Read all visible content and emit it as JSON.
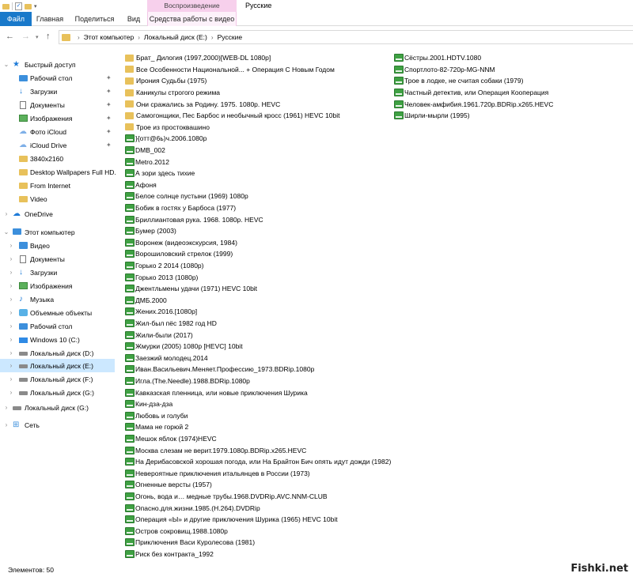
{
  "ribbon": {
    "context_group": "Воспроизведение",
    "window_title": "Русские",
    "tabs": {
      "file": "Файл",
      "home": "Главная",
      "share": "Поделиться",
      "view": "Вид",
      "video_tools": "Средства работы с видео"
    }
  },
  "address": {
    "crumbs": [
      "Этот компьютер",
      "Локальный диск (E:)",
      "Русские"
    ]
  },
  "sidebar": {
    "quick_access": "Быстрый доступ",
    "quick_items": [
      {
        "label": "Рабочий стол",
        "icon": "desktop-icon"
      },
      {
        "label": "Загрузки",
        "icon": "download-icon"
      },
      {
        "label": "Документы",
        "icon": "documents-icon"
      },
      {
        "label": "Изображения",
        "icon": "pictures-icon"
      },
      {
        "label": "Фото iCloud",
        "icon": "icloud-photos-icon"
      },
      {
        "label": "iCloud Drive",
        "icon": "icloud-drive-icon"
      },
      {
        "label": "3840x2160",
        "icon": "folder-icon"
      },
      {
        "label": "Desktop Wallpapers Full HD. I",
        "icon": "folder-icon"
      },
      {
        "label": "From Internet",
        "icon": "folder-icon"
      },
      {
        "label": "Video",
        "icon": "folder-icon"
      }
    ],
    "onedrive": "OneDrive",
    "this_pc": "Этот компьютер",
    "pc_items": [
      {
        "label": "Видео",
        "icon": "videos-icon"
      },
      {
        "label": "Документы",
        "icon": "documents-icon"
      },
      {
        "label": "Загрузки",
        "icon": "download-icon"
      },
      {
        "label": "Изображения",
        "icon": "pictures-icon"
      },
      {
        "label": "Музыка",
        "icon": "music-icon"
      },
      {
        "label": "Объемные объекты",
        "icon": "3d-objects-icon"
      },
      {
        "label": "Рабочий стол",
        "icon": "desktop-icon"
      },
      {
        "label": "Windows 10 (C:)",
        "icon": "windows-drive-icon"
      },
      {
        "label": "Локальный диск (D:)",
        "icon": "drive-icon"
      },
      {
        "label": "Локальный диск (E:)",
        "icon": "drive-icon"
      },
      {
        "label": "Локальный диск (F:)",
        "icon": "drive-icon"
      },
      {
        "label": "Локальный диск (G:)",
        "icon": "drive-icon"
      }
    ],
    "extra_drive": "Локальный диск (G:)",
    "network": "Сеть"
  },
  "files": {
    "column1": [
      {
        "name": "Брат_ Дилогия (1997,2000)[WEB-DL 1080p]",
        "type": "folder"
      },
      {
        "name": "Все Особенности Национальной... + Операция С Новым Годом",
        "type": "folder"
      },
      {
        "name": "Ирония Судьбы (1975)",
        "type": "folder"
      },
      {
        "name": "Каникулы строгого режима",
        "type": "folder"
      },
      {
        "name": "Они сражались за Родину. 1975. 1080p. HEVC",
        "type": "folder"
      },
      {
        "name": "Самогонщики, Пес Барбос и необычный кросс (1961) HEVC 10bit",
        "type": "folder"
      },
      {
        "name": "Трое из простоквашино",
        "type": "folder"
      },
      {
        "name": "}{отт@6ь)ч.2006.1080p",
        "type": "video"
      },
      {
        "name": "DMB_002",
        "type": "video"
      },
      {
        "name": "Metro.2012",
        "type": "video"
      },
      {
        "name": "А зори здесь тихие",
        "type": "video"
      },
      {
        "name": "Афоня",
        "type": "video"
      },
      {
        "name": "Белое солнце пустыни (1969) 1080p",
        "type": "video"
      },
      {
        "name": "Бобик в гостях у Барбоса (1977)",
        "type": "video"
      },
      {
        "name": "Бриллиантовая рука. 1968. 1080p. HEVC",
        "type": "video"
      },
      {
        "name": "Бумер (2003)",
        "type": "video"
      },
      {
        "name": "Воронеж (видеоэкскурсия, 1984)",
        "type": "video"
      },
      {
        "name": "Ворошиловский стрелок (1999)",
        "type": "video"
      },
      {
        "name": "Горько 2 2014 (1080p)",
        "type": "video"
      },
      {
        "name": "Горько 2013 (1080p)",
        "type": "video"
      },
      {
        "name": "Джентльмены удачи (1971) HEVC 10bit",
        "type": "video"
      },
      {
        "name": "ДМБ.2000",
        "type": "video"
      },
      {
        "name": "Жених.2016.[1080p]",
        "type": "video"
      },
      {
        "name": "Жил-был пёс 1982 год HD",
        "type": "video"
      },
      {
        "name": "Жили-были (2017)",
        "type": "video"
      },
      {
        "name": "Жмурки (2005) 1080p [HEVC] 10bit",
        "type": "video"
      },
      {
        "name": "Заезжий молодец.2014",
        "type": "video"
      },
      {
        "name": "Иван.Васильевич.Меняет.Профессию_1973.BDRip.1080p",
        "type": "video"
      },
      {
        "name": "Игла.(The.Needle).1988.BDRip.1080p",
        "type": "video"
      },
      {
        "name": "Кавказская пленница, или новые приключения Шурика",
        "type": "video"
      },
      {
        "name": "Кин-дза-дза",
        "type": "video"
      },
      {
        "name": "Любовь и голуби",
        "type": "video"
      },
      {
        "name": "Мама не горюй 2",
        "type": "video"
      },
      {
        "name": "Мешок яблок (1974)HEVC",
        "type": "video"
      },
      {
        "name": "Москва слезам не верит.1979.1080p.BDRip.x265.HEVC",
        "type": "video"
      },
      {
        "name": "На Дерибасовской хорошая погода, или На Брайтон Бич опять идут дожди (1982)",
        "type": "video"
      },
      {
        "name": "Невероятные приключения итальянцев в России (1973)",
        "type": "video"
      },
      {
        "name": "Огненные версты (1957)",
        "type": "video"
      },
      {
        "name": "Огонь, вода и… медные трубы.1968.DVDRip.AVC.NNM-CLUB",
        "type": "video"
      },
      {
        "name": "Опасно.для.жизни.1985.(H.264).DVDRip",
        "type": "video"
      },
      {
        "name": "Операция «Ы» и другие приключения Шурика (1965) HEVC 10bit",
        "type": "video"
      },
      {
        "name": "Остров сокровищ.1988.1080p",
        "type": "video"
      },
      {
        "name": "Приключения Васи Куролесова (1981)",
        "type": "video"
      },
      {
        "name": "Риск без контракта_1992",
        "type": "video"
      }
    ],
    "column2": [
      {
        "name": "Сёстры.2001.HDTV.1080",
        "type": "video"
      },
      {
        "name": "Спортлото-82-720p-MG-NNM",
        "type": "video"
      },
      {
        "name": "Трое в лодке, не считая собаки (1979)",
        "type": "video"
      },
      {
        "name": "Частный детектив, или Операция Кооперация",
        "type": "video"
      },
      {
        "name": "Человек-амфибия.1961.720p.BDRip.x265.HEVC",
        "type": "video"
      },
      {
        "name": "Ширли-мырли (1995)",
        "type": "video"
      }
    ]
  },
  "status": {
    "count": "Элементов: 50"
  },
  "watermark": "Fishki.net",
  "colors": {
    "file_tab": "#1979ca",
    "context_tab": "#f7d0ec",
    "selected_nav": "#cce8ff",
    "folder": "#e8c15b",
    "video_icon": "#3fa143"
  }
}
